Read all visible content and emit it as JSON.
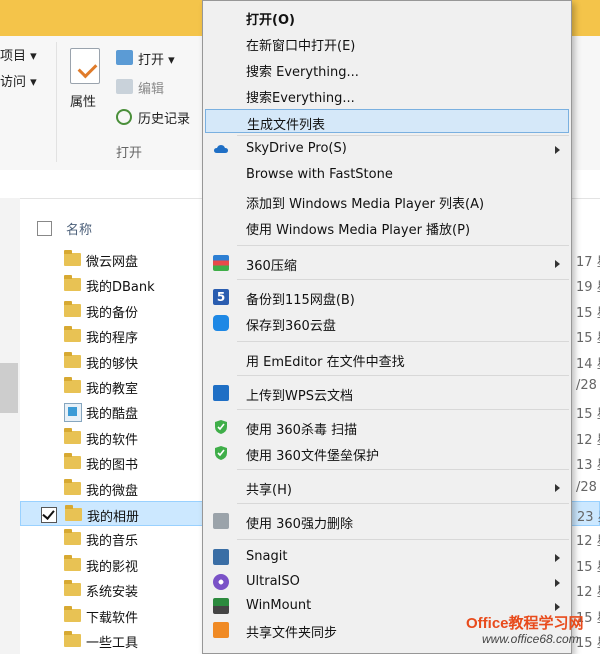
{
  "ribbon": {
    "item_project": "项目 ▾",
    "item_access": "访问 ▾",
    "open_label": "打开 ▾",
    "edit_label": "编辑",
    "history_label": "历史记录",
    "properties_label": "属性",
    "group_open": "打开"
  },
  "file_list": {
    "header_name": "名称",
    "rows": [
      {
        "name": "微云网盘",
        "date": "17 星"
      },
      {
        "name": "我的DBank",
        "date": "19 星"
      },
      {
        "name": "我的备份",
        "date": "15 星"
      },
      {
        "name": "我的程序",
        "date": "15 星"
      },
      {
        "name": "我的够快",
        "date": "14 星"
      },
      {
        "name": "我的教室",
        "date": "/28"
      },
      {
        "name": "我的酷盘",
        "date": "15 星"
      },
      {
        "name": "我的软件",
        "date": "12 星"
      },
      {
        "name": "我的图书",
        "date": "13 星"
      },
      {
        "name": "我的微盘",
        "date": "/28"
      },
      {
        "name": "我的相册",
        "date": "23 星"
      },
      {
        "name": "我的音乐",
        "date": "12 星"
      },
      {
        "name": "我的影视",
        "date": "15 星"
      },
      {
        "name": "系统安装",
        "date": "12 星"
      },
      {
        "name": "下载软件",
        "date": "15 星"
      },
      {
        "name": "一些工具",
        "date": "15 星"
      }
    ]
  },
  "menu": {
    "open": "打开(O)",
    "open_new_window": "在新窗口中打开(E)",
    "search_everything_1": "搜索 Everything...",
    "search_everything_2": "搜索Everything...",
    "generate_list": "生成文件列表",
    "skydrive": "SkyDrive Pro(S)",
    "faststone": "Browse with FastStone",
    "wmp_add": "添加到 Windows Media Player 列表(A)",
    "wmp_play": "使用 Windows Media Player 播放(P)",
    "compress_360": "360压缩",
    "backup_115": "备份到115网盘(B)",
    "save_360cloud": "保存到360云盘",
    "emeditor": "用 EmEditor 在文件中查找",
    "wps_upload": "上传到WPS云文档",
    "scan_360": "使用 360杀毒 扫描",
    "fortress_360": "使用 360文件堡垒保护",
    "share": "共享(H)",
    "force_delete_360": "使用 360强力删除",
    "snagit": "Snagit",
    "ultraiso": "UltraISO",
    "winmount": "WinMount",
    "share_sync": "共享文件夹同步"
  },
  "watermark": {
    "brand": "Office教程学习网",
    "url": "www.office68.com"
  },
  "colors": {
    "highlight": "#d5e8f9",
    "selected_row": "#cce8ff",
    "folder": "#e8c254",
    "title_bar": "#f4c44a"
  }
}
